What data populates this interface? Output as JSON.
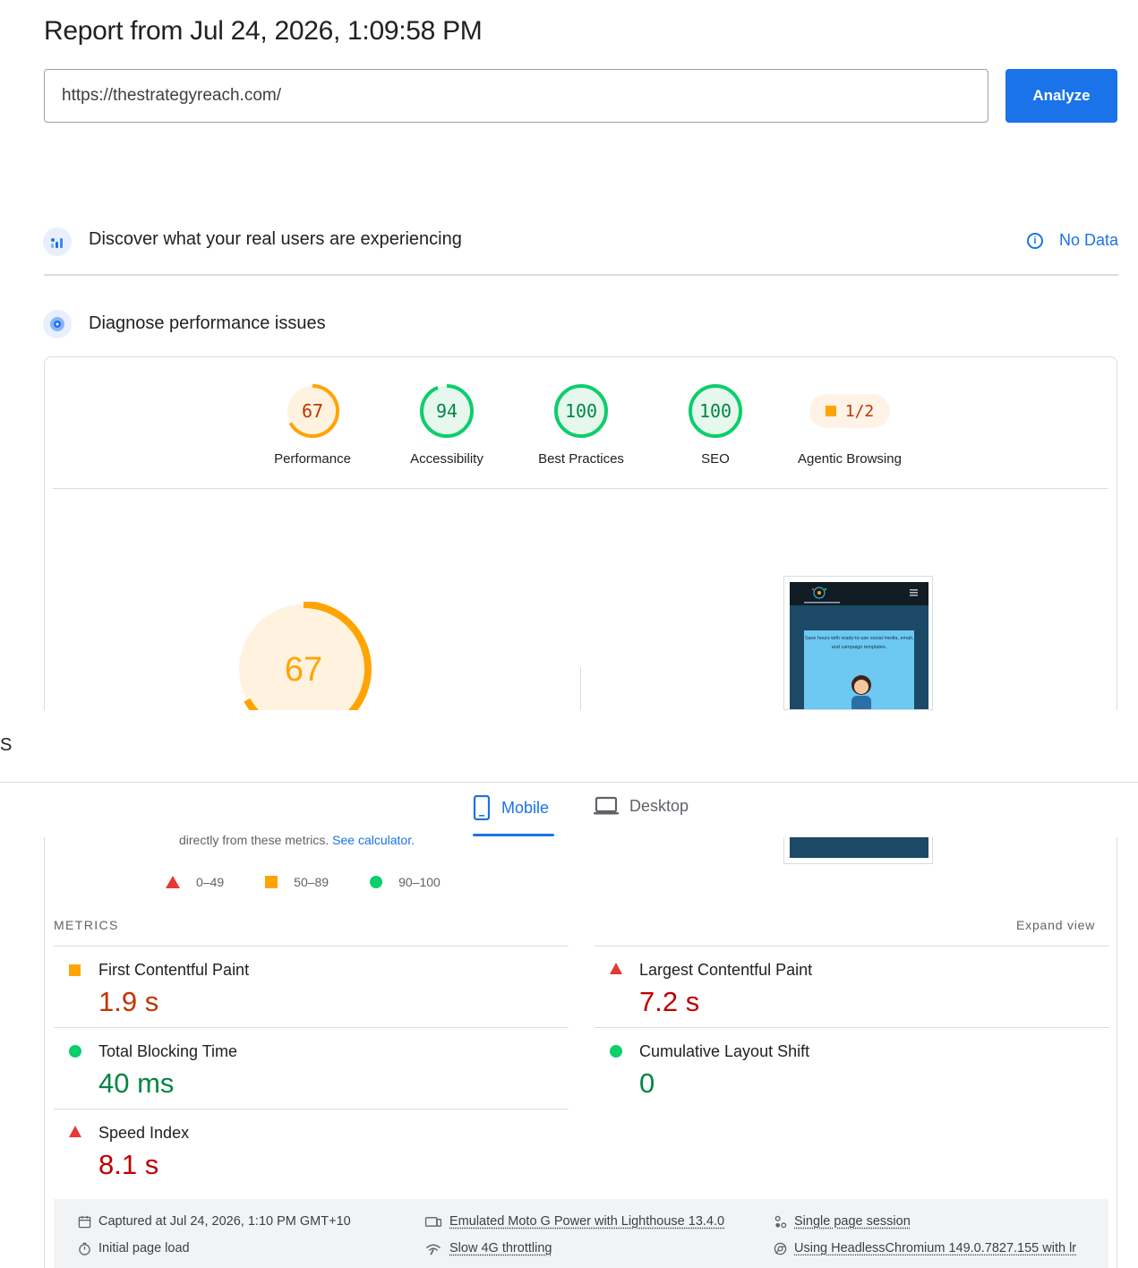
{
  "header": {
    "title": "Report from Jul 24, 2026, 1:09:58 PM",
    "url_value": "https://thestrategyreach.com/",
    "analyze_label": "Analyze"
  },
  "crux": {
    "title": "Discover what your real users are experiencing",
    "no_data_label": "No Data"
  },
  "diagnose": {
    "title": "Diagnose performance issues"
  },
  "scores": [
    {
      "label": "Performance",
      "value": "67",
      "rating": "average"
    },
    {
      "label": "Accessibility",
      "value": "94",
      "rating": "pass"
    },
    {
      "label": "Best Practices",
      "value": "100",
      "rating": "pass"
    },
    {
      "label": "SEO",
      "value": "100",
      "rating": "pass"
    },
    {
      "label": "Agentic Browsing",
      "value": "1/2",
      "rating": "average"
    }
  ],
  "big_gauge": {
    "value": "67",
    "fraction": 0.67
  },
  "partial_letter": "S",
  "tabs": {
    "mobile": "Mobile",
    "desktop": "Desktop"
  },
  "calculator": {
    "text": "directly from these metrics.",
    "link": "See calculator."
  },
  "legend": {
    "fail": "0–49",
    "average": "50–89",
    "pass": "90–100"
  },
  "metrics": {
    "header": "METRICS",
    "expand_label": "Expand view",
    "items": [
      {
        "name": "First Contentful Paint",
        "value": "1.9 s",
        "rating": "average"
      },
      {
        "name": "Largest Contentful Paint",
        "value": "7.2 s",
        "rating": "fail"
      },
      {
        "name": "Total Blocking Time",
        "value": "40 ms",
        "rating": "pass"
      },
      {
        "name": "Cumulative Layout Shift",
        "value": "0",
        "rating": "pass"
      },
      {
        "name": "Speed Index",
        "value": "8.1 s",
        "rating": "fail"
      }
    ]
  },
  "thumbnail": {
    "caption": "Save hours with ready-to-use social media, email, and campaign templates."
  },
  "footer": {
    "captured": "Captured at Jul 24, 2026, 1:10 PM GMT+10",
    "initial_load": "Initial page load",
    "emulated": "Emulated Moto G Power with Lighthouse 13.4.0",
    "throttling": "Slow 4G throttling",
    "session": "Single page session",
    "browser": "Using HeadlessChromium 149.0.7827.155 with lr"
  },
  "colors": {
    "accent": "#1a73e8",
    "fail": "#e53935",
    "average": "#ffa400",
    "pass": "#0cce6b"
  }
}
